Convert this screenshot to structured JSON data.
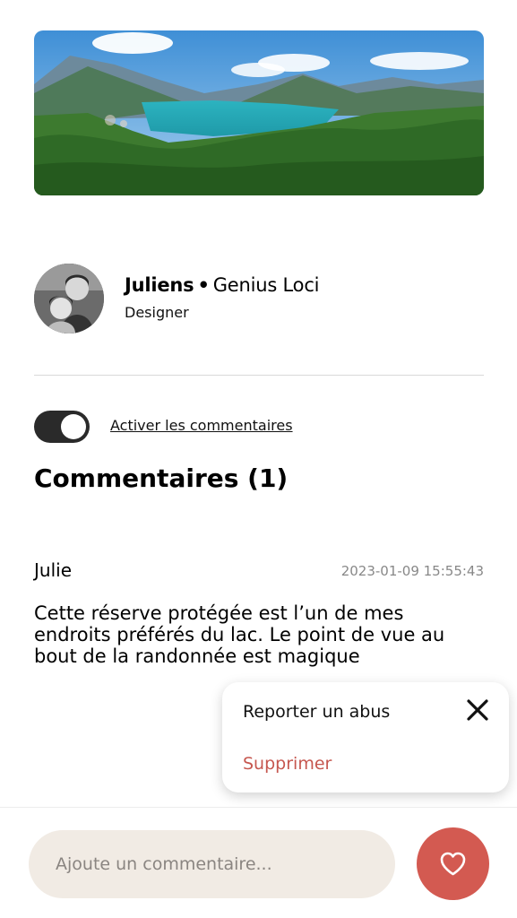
{
  "hero": {
    "alt": "Lake landscape"
  },
  "author": {
    "name": "Juliens",
    "separator": "•",
    "org": "Genius Loci",
    "role": "Designer"
  },
  "comments_toggle": {
    "label": "Activer les commentaires",
    "enabled": true
  },
  "comments": {
    "title": "Commentaires (1)",
    "items": [
      {
        "author": "Julie",
        "date": "2023-01-09 15:55:43",
        "text": "Cette réserve protégée est l’un de mes endroits préférés du lac. Le point de vue au bout de la randonnée est magique"
      }
    ]
  },
  "popup": {
    "report_label": "Reporter un abus",
    "delete_label": "Supprimer",
    "close_icon": "close-icon"
  },
  "composer": {
    "placeholder": "Ajoute un commentaire...",
    "value": "",
    "like_icon": "heart-icon"
  },
  "colors": {
    "accent": "#d35a51",
    "input_bg": "#f1ebe4",
    "toggle_on": "#2a2a2a",
    "delete_text": "#c6574f"
  }
}
